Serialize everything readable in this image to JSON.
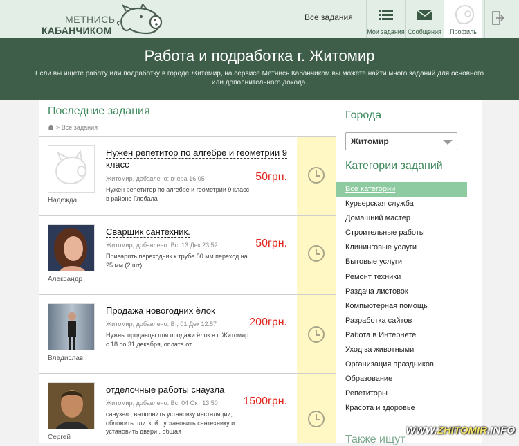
{
  "header": {
    "logo_line1": "МЕТНИСЬ",
    "logo_line2": "КАБАНЧИКОМ",
    "nav_all_tasks": "Все задания",
    "nav_buttons": [
      {
        "label": "Мои задания",
        "icon": "list-icon"
      },
      {
        "label": "Сообщения",
        "icon": "envelope-icon"
      },
      {
        "label": "Профиль",
        "icon": "avatar-icon"
      }
    ],
    "exit_icon": "logout-icon"
  },
  "banner": {
    "title": "Работа и подработка г. Житомир",
    "text": "Если вы ищете работу или подработку в городе Житомир, на сервисе Метнись Кабанчиком вы можете найти много заданий для основного или дополнительного дохода."
  },
  "main": {
    "title": "Последние задания",
    "breadcrumb": "Все задания",
    "tasks": [
      {
        "user": "Надежда",
        "title": "Нужен репетитор по алгебре и геометрии 9 класс",
        "meta": "Житомир, добавлено: вчера 16:05",
        "desc": "Нужен репетитор по алгебре и геометрии 9 класс в районе Глобала",
        "price": "50грн."
      },
      {
        "user": "Александр",
        "title": "Сварщик сантехник.",
        "meta": "Житомир, добавлено: Вс, 13 Дек 23:52",
        "desc": "Приварить переходник к трубе 50 мм переход на 25 мм (2 шт)",
        "price": "50грн."
      },
      {
        "user": "Владислав .",
        "title": "Продажа новогодних ёлок",
        "meta": "Житомир, добавлено: Вт, 01 Дек 12:57",
        "desc": "Нужны продавцы для продажи ёлок в г. Житомир с 18 по 31 декабря, оплата от",
        "price": "200грн."
      },
      {
        "user": "Сергей",
        "title": "отделочные работы снаузла",
        "meta": "Житомир, добавлено: Вс, 04 Окт 13:50",
        "desc": "санузел , выполнить установку инсталяции, обложить плиткой , установить сантехнику и установить двери . общая",
        "price": "1500грн."
      }
    ]
  },
  "sidebar": {
    "cities_title": "Города",
    "city_selected": "Житомир",
    "categories_title": "Категории заданий",
    "categories": [
      "Все категории",
      "Курьерская служба",
      "Домашний мастер",
      "Строительные работы",
      "Клининговые услуги",
      "Бытовые услуги",
      "Ремонт техники",
      "Раздача листовок",
      "Компьютерная помощь",
      "Разработка сайтов",
      "Работа в Интернете",
      "Уход за животными",
      "Организация праздников",
      "Образование",
      "Репетиторы",
      "Красота и здоровье"
    ],
    "also_title": "Также ищут"
  },
  "watermark": {
    "prefix": "WWW.",
    "name": "ZHITOMIR",
    "suffix": ".INFO"
  }
}
